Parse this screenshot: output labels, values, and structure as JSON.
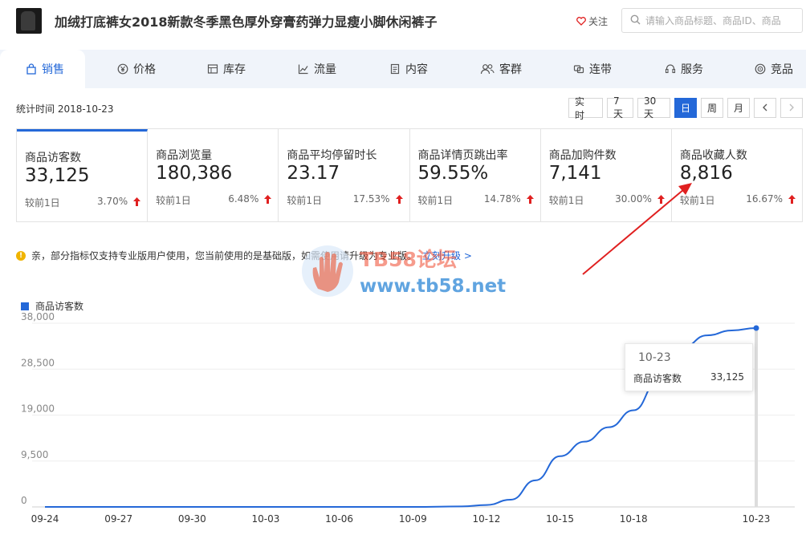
{
  "header": {
    "product_title": "加绒打底裤女2018新款冬季黑色厚外穿膏药弹力显瘦小脚休闲裤子",
    "follow_label": "关注",
    "search_placeholder": "请输入商品标题、商品ID、商品"
  },
  "tabs": [
    {
      "label": "销售",
      "icon": "bag-icon",
      "active": true
    },
    {
      "label": "价格",
      "icon": "yen-icon"
    },
    {
      "label": "库存",
      "icon": "warehouse-icon"
    },
    {
      "label": "流量",
      "icon": "line-chart-icon"
    },
    {
      "label": "内容",
      "icon": "document-icon"
    },
    {
      "label": "客群",
      "icon": "people-icon"
    },
    {
      "label": "连带",
      "icon": "link-icon"
    },
    {
      "label": "服务",
      "icon": "headset-icon"
    },
    {
      "label": "竞品",
      "icon": "target-icon"
    }
  ],
  "statbar": {
    "time_label": "统计时间 2018-10-23",
    "buttons": [
      "实 时",
      "7天",
      "30天",
      "日",
      "周",
      "月"
    ],
    "active_button": "日"
  },
  "metrics": [
    {
      "title": "商品访客数",
      "value": "33,125",
      "compare": "较前1日",
      "pct": "3.70%"
    },
    {
      "title": "商品浏览量",
      "value": "180,386",
      "compare": "较前1日",
      "pct": "6.48%"
    },
    {
      "title": "商品平均停留时长",
      "value": "23.17",
      "compare": "较前1日",
      "pct": "17.53%"
    },
    {
      "title": "商品详情页跳出率",
      "value": "59.55%",
      "compare": "较前1日",
      "pct": "14.78%"
    },
    {
      "title": "商品加购件数",
      "value": "7,141",
      "compare": "较前1日",
      "pct": "30.00%"
    },
    {
      "title": "商品收藏人数",
      "value": "8,816",
      "compare": "较前1日",
      "pct": "16.67%"
    }
  ],
  "notice": {
    "text": "亲，部分指标仅支持专业版用户使用，您当前使用的是基础版，如需使用请升级为专业版。",
    "link": "立刻升级 >"
  },
  "watermark": {
    "text": "TB58论坛",
    "url": "www.tb58.net"
  },
  "colors": {
    "accent": "#2468d8",
    "up": "#e02020",
    "annotation": "#e02020"
  },
  "tooltip": {
    "date": "10-23",
    "label": "商品访客数",
    "value": "33,125"
  },
  "chart_data": {
    "type": "line",
    "legend": "商品访客数",
    "ylim": [
      0,
      38000
    ],
    "yticks": [
      "38,000",
      "28,500",
      "19,000",
      "9,500",
      "0"
    ],
    "xticks": [
      "09-24",
      "09-27",
      "09-30",
      "10-03",
      "10-06",
      "10-09",
      "10-12",
      "10-15",
      "10-18",
      "10-23"
    ],
    "series": [
      {
        "name": "商品访客数",
        "points": [
          [
            "09-24",
            0
          ],
          [
            "09-27",
            0
          ],
          [
            "09-30",
            0
          ],
          [
            "10-03",
            0
          ],
          [
            "10-06",
            0
          ],
          [
            "10-09",
            0
          ],
          [
            "10-11",
            100
          ],
          [
            "10-12",
            400
          ],
          [
            "10-13",
            1500
          ],
          [
            "10-14",
            5500
          ],
          [
            "10-15",
            10500
          ],
          [
            "10-16",
            13500
          ],
          [
            "10-17",
            16500
          ],
          [
            "10-18",
            20000
          ],
          [
            "10-19",
            26000
          ],
          [
            "10-20",
            33000
          ],
          [
            "10-21",
            35500
          ],
          [
            "10-22",
            36500
          ],
          [
            "10-23",
            37000
          ]
        ]
      }
    ]
  }
}
